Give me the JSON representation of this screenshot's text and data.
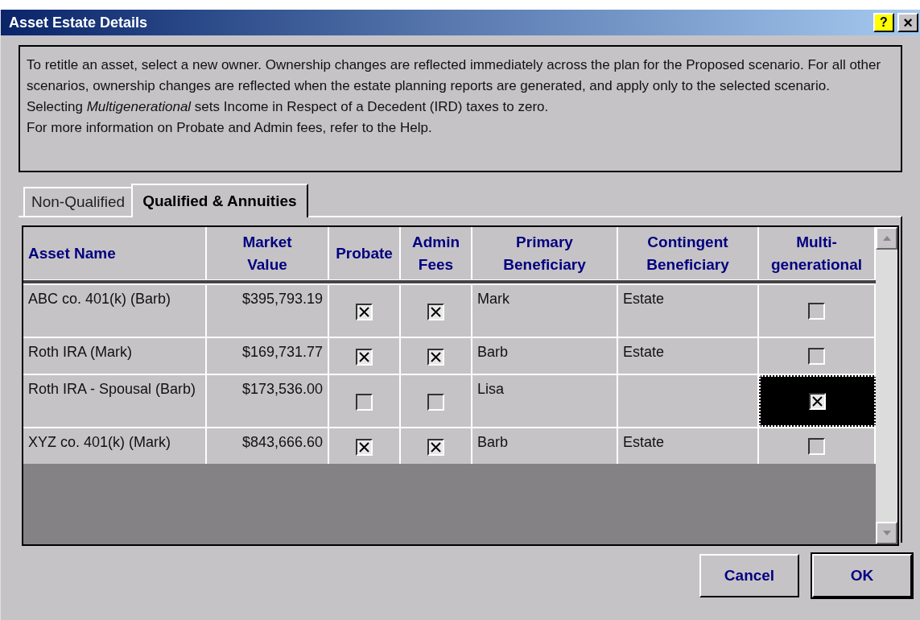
{
  "window": {
    "title": "Asset Estate Details",
    "help_button": "?",
    "close_button": "×"
  },
  "info": [
    "To retitle an asset, select a new owner.  Ownership changes are reflected immediately across the plan for the Proposed scenario.  For all other scenarios, ownership changes are reflected when the estate planning reports are generated, and apply only to the selected scenario.",
    "Selecting *Multigenerational* sets Income in Respect of a Decedent (IRD) taxes to zero.",
    "For more information on Probate and Admin fees, refer to the Help."
  ],
  "tabs": [
    {
      "label": "Non-Qualified",
      "selected": false
    },
    {
      "label": "Qualified & Annuities",
      "selected": true
    }
  ],
  "table": {
    "columns": [
      "Asset Name",
      "Market Value",
      "Probate",
      "Admin Fees",
      "Primary Beneficiary",
      "Contingent Beneficiary",
      "Multi- generational"
    ],
    "rows": [
      {
        "asset_name": "ABC co. 401(k) (Barb)",
        "market_value": "$395,793.19",
        "probate": true,
        "admin_fees": true,
        "primary": "Mark",
        "contingent": "Estate",
        "multigenerational": false,
        "focused": false
      },
      {
        "asset_name": "Roth IRA (Mark)",
        "market_value": "$169,731.77",
        "probate": true,
        "admin_fees": true,
        "primary": "Barb",
        "contingent": "Estate",
        "multigenerational": false,
        "focused": false
      },
      {
        "asset_name": "Roth IRA - Spousal (Barb)",
        "market_value": "$173,536.00",
        "probate": false,
        "admin_fees": false,
        "primary": "Lisa",
        "multigenerational": true,
        "focused": true
      },
      {
        "asset_name": "XYZ co. 401(k) (Mark)",
        "market_value": "$843,666.60",
        "probate": true,
        "admin_fees": true,
        "primary": "Barb",
        "contingent": "Estate",
        "multigenerational": false,
        "focused": false
      }
    ]
  },
  "buttons": [
    "Cancel",
    "OK"
  ]
}
